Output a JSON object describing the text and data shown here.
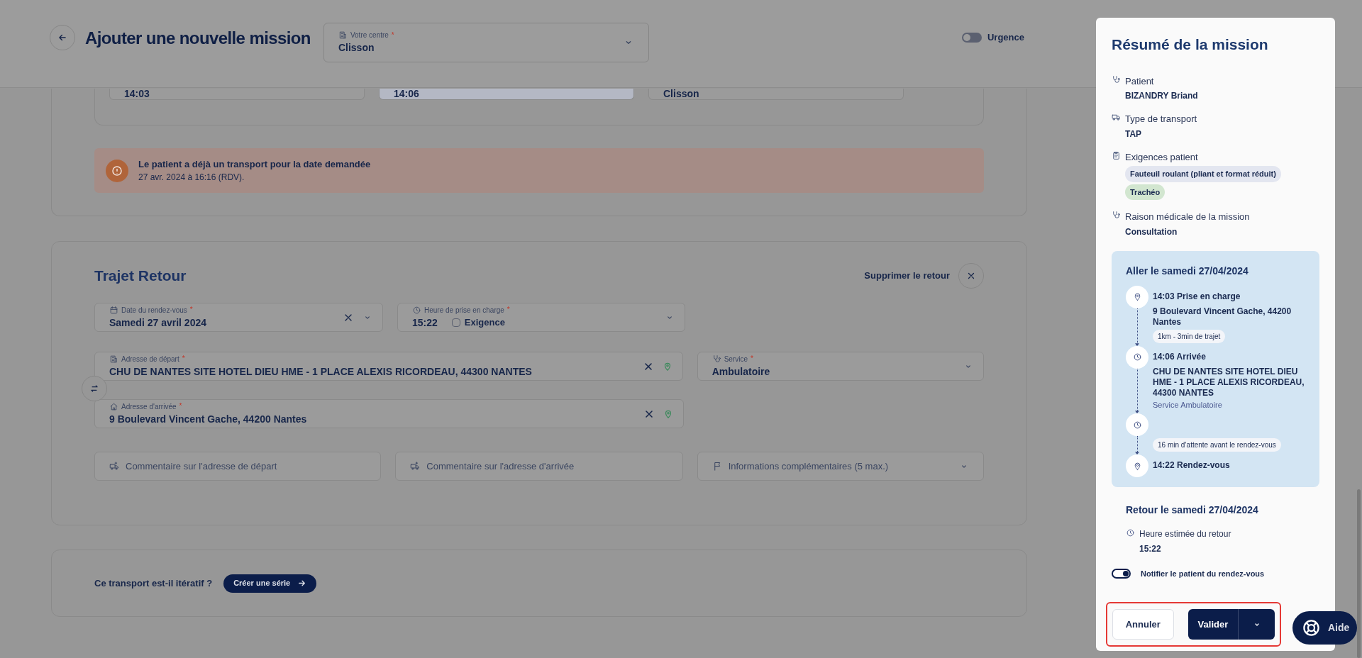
{
  "header": {
    "title": "Ajouter une nouvelle mission",
    "center": {
      "label": "Votre centre",
      "required": "*",
      "value": "Clisson"
    },
    "urgence": {
      "label": "Urgence",
      "on": false
    }
  },
  "aller_fields": [
    {
      "value": "14:03",
      "disabled": false
    },
    {
      "value": "14:06",
      "disabled": true
    },
    {
      "value": "Clisson",
      "disabled": false
    }
  ],
  "alert": {
    "title": "Le patient a déjà un transport pour la date demandée",
    "text": "27 avr. 2024 à 16:16 (RDV)."
  },
  "return_trip": {
    "title": "Trajet Retour",
    "remove_label": "Supprimer le retour",
    "date_field": {
      "label": "Date du rendez-vous",
      "required": "*",
      "value": "Samedi 27 avril 2024"
    },
    "time_field": {
      "label": "Heure de prise en charge",
      "required": "*",
      "value": "15:22",
      "exigence": {
        "label": "Exigence",
        "checked": false
      }
    },
    "departure": {
      "label": "Adresse de départ",
      "required": "*",
      "value": "CHU DE NANTES SITE HOTEL DIEU HME - 1 PLACE ALEXIS RICORDEAU, 44300 NANTES"
    },
    "service": {
      "label": "Service",
      "required": "*",
      "value": "Ambulatoire"
    },
    "arrival": {
      "label": "Adresse d'arrivée",
      "required": "*",
      "value": "9 Boulevard Vincent Gache, 44200 Nantes"
    },
    "comments": [
      {
        "kind": "departure",
        "placeholder": "Commentaire sur l'adresse de départ"
      },
      {
        "kind": "arrival",
        "placeholder": "Commentaire sur l'adresse d'arrivée"
      },
      {
        "kind": "info",
        "placeholder": "Informations complémentaires (5 max.)"
      }
    ]
  },
  "series": {
    "question": "Ce transport est-il itératif ?",
    "button": "Créer une série"
  },
  "summary": {
    "title": "Résumé de la mission",
    "items": [
      {
        "kind": "stethoscope",
        "label": "Patient",
        "value": "BIZANDRY Briand"
      },
      {
        "kind": "truck",
        "label": "Type de transport",
        "value": "TAP"
      },
      {
        "kind": "clipboard",
        "label": "Exigences patient",
        "tags": [
          {
            "text": "Fauteuil roulant (pliant et format réduit)",
            "color": "#e3e6f0"
          },
          {
            "text": "Trachéo",
            "color": "#d2e6d0"
          }
        ]
      },
      {
        "kind": "stethoscope",
        "label": "Raison médicale de la mission",
        "value": "Consultation"
      }
    ],
    "aller": {
      "title": "Aller le samedi 27/04/2024",
      "steps": [
        {
          "kind": "pin",
          "heading": "14:03 Prise en charge",
          "address": "9 Boulevard Vincent Gache, 44200 Nantes",
          "badge": "1km - 3min de trajet"
        },
        {
          "kind": "clock",
          "heading": "14:06 Arrivée",
          "address": "CHU DE NANTES SITE HOTEL DIEU HME - 1 PLACE ALEXIS RICORDEAU, 44300 NANTES",
          "service": "Service Ambulatoire"
        },
        {
          "kind": "clock",
          "badge": "16 min d’attente avant le rendez-vous"
        },
        {
          "kind": "pin",
          "heading": "14:22 Rendez-vous"
        }
      ]
    },
    "retour": {
      "title": "Retour le samedi 27/04/2024",
      "label": "Heure estimée du retour",
      "value": "15:22"
    },
    "notify": {
      "label": "Notifier le patient du rendez-vous",
      "on": true
    },
    "actions": {
      "highlighted": true,
      "cancel": "Annuler",
      "confirm": "Valider"
    }
  },
  "help": {
    "label": "Aide"
  }
}
